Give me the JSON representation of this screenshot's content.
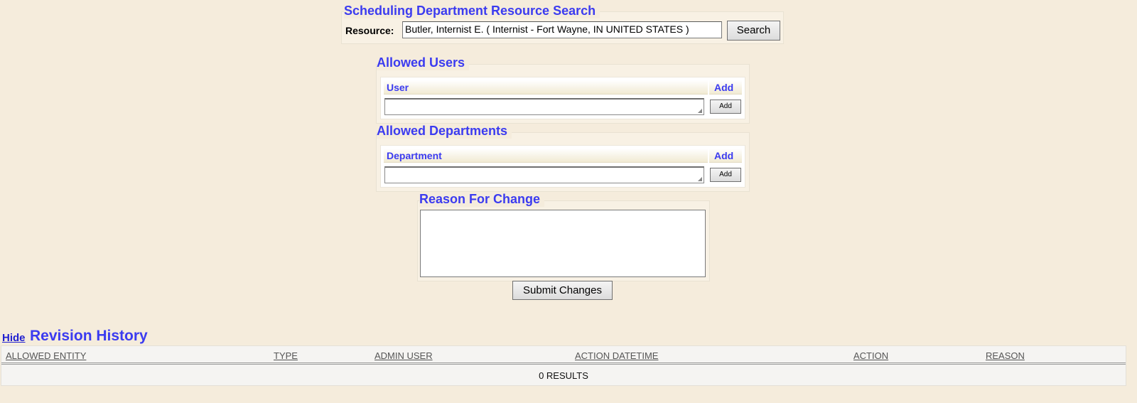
{
  "search": {
    "legend": "Scheduling Department Resource Search",
    "resource_label": "Resource:",
    "resource_value": "Butler, Internist E. ( Internist -  Fort Wayne, IN UNITED STATES )",
    "search_button": "Search"
  },
  "allowed_users": {
    "legend": "Allowed Users",
    "column_label": "User",
    "add_header": "Add",
    "add_button": "Add"
  },
  "allowed_departments": {
    "legend": "Allowed Departments",
    "column_label": "Department",
    "add_header": "Add",
    "add_button": "Add"
  },
  "reason": {
    "legend": "Reason For Change",
    "value": "",
    "submit_button": "Submit Changes"
  },
  "revision_history": {
    "hide_link": "Hide",
    "title": "Revision History",
    "columns": [
      "ALLOWED ENTITY",
      "TYPE",
      "ADMIN USER",
      "ACTION DATETIME",
      "ACTION",
      "REASON"
    ],
    "results_text": "0 RESULTS"
  },
  "colors": {
    "background": "#f5ecdc",
    "accent": "#3b3bf0"
  }
}
